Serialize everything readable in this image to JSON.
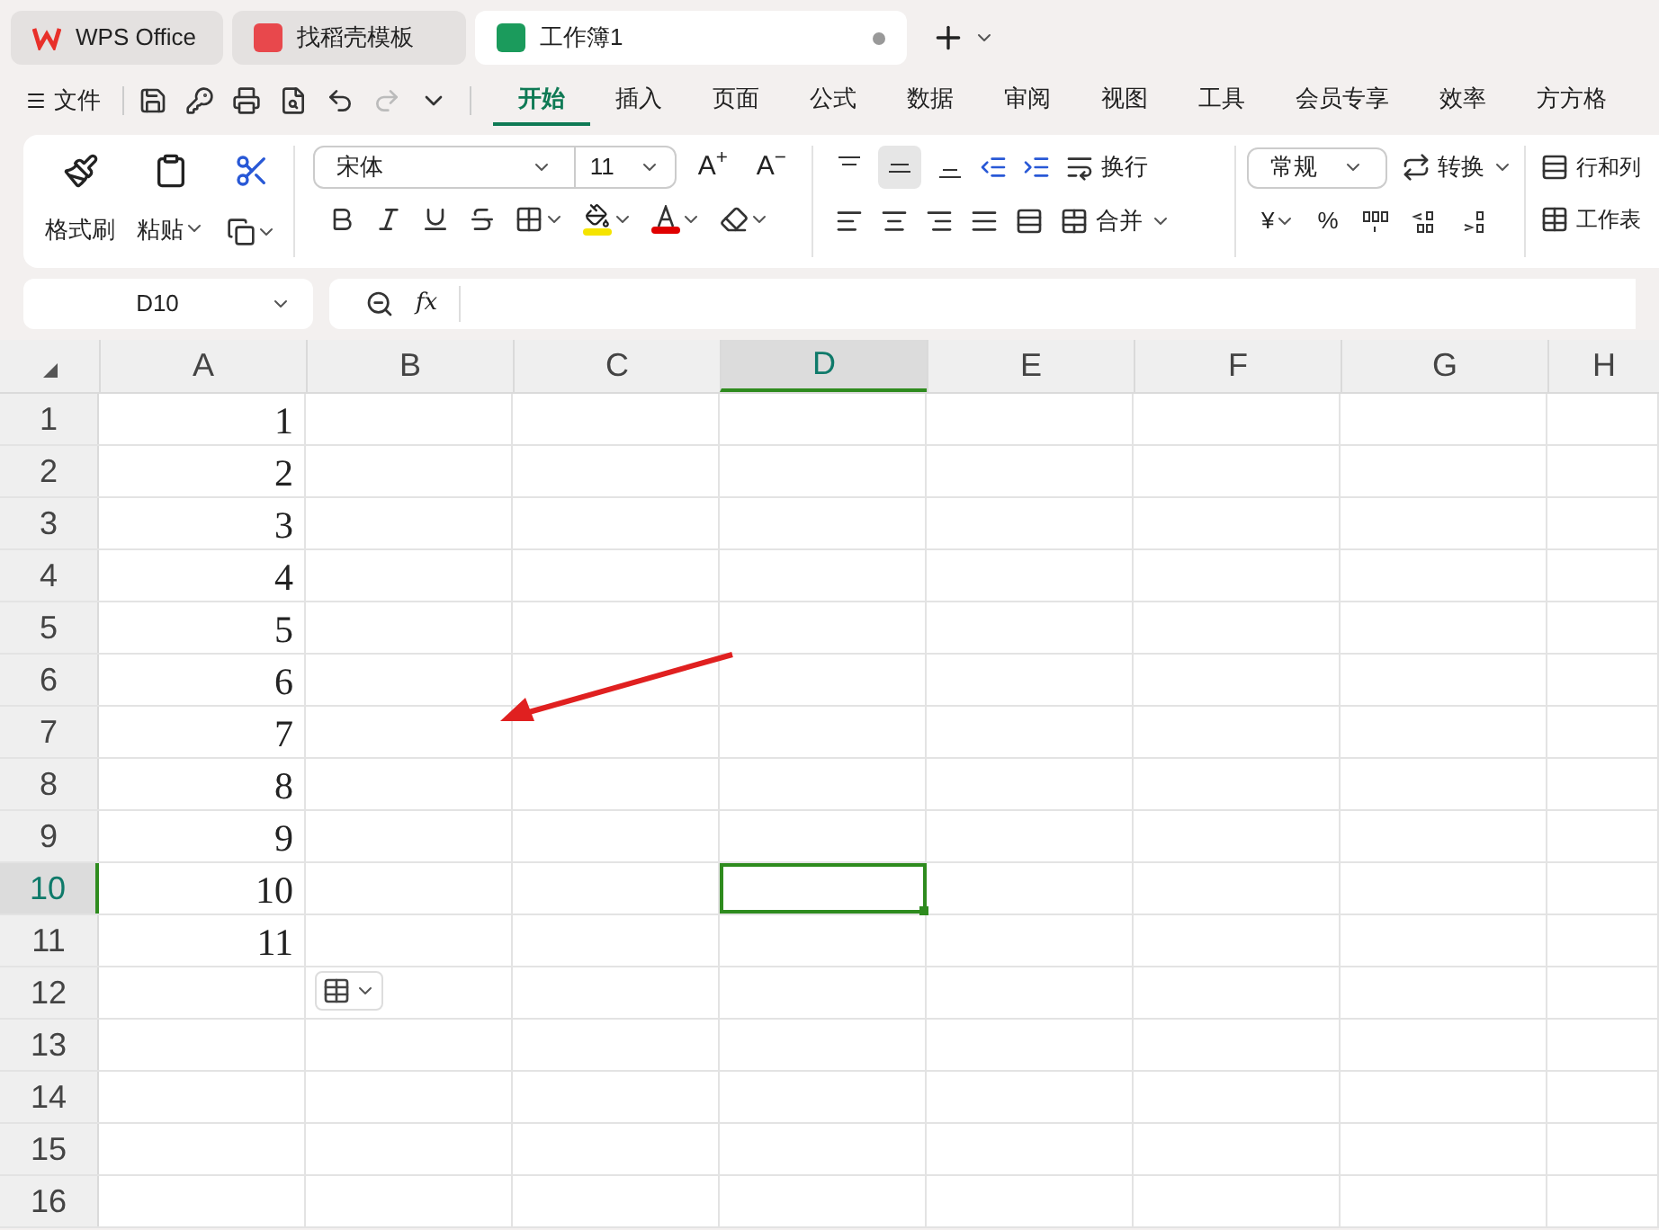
{
  "tabs": [
    {
      "label": "WPS Office",
      "kind": "home",
      "selected": false
    },
    {
      "label": "找稻壳模板",
      "kind": "template",
      "selected": false
    },
    {
      "label": "工作簿1",
      "kind": "sheet",
      "selected": true
    }
  ],
  "menu": {
    "file": "文件",
    "items": [
      {
        "label": "开始",
        "selected": true
      },
      {
        "label": "插入",
        "selected": false
      },
      {
        "label": "页面",
        "selected": false
      },
      {
        "label": "公式",
        "selected": false
      },
      {
        "label": "数据",
        "selected": false
      },
      {
        "label": "审阅",
        "selected": false
      },
      {
        "label": "视图",
        "selected": false
      },
      {
        "label": "工具",
        "selected": false
      },
      {
        "label": "会员专享",
        "selected": false
      },
      {
        "label": "效率",
        "selected": false
      },
      {
        "label": "方方格",
        "selected": false
      }
    ]
  },
  "ribbon": {
    "format_painter": "格式刷",
    "paste": "粘贴",
    "font": "宋体",
    "font_size": "11",
    "grow_font": "A$^{+}$",
    "shrink_font": "A$^{−}$",
    "vertical_align": [
      {
        "selected": false
      },
      {
        "selected": true
      },
      {
        "selected": false
      }
    ],
    "wrap": "换行",
    "merge": "合并",
    "number_format": "常规",
    "convert": "转换",
    "currency": "¥",
    "percent": "%",
    "rows_cols": "行和列",
    "worksheet": "工作表"
  },
  "name_box": "D10",
  "function_label": "fx",
  "columns": [
    {
      "label": "A",
      "selected": false
    },
    {
      "label": "B",
      "selected": false
    },
    {
      "label": "C",
      "selected": false
    },
    {
      "label": "D",
      "selected": true
    },
    {
      "label": "E",
      "selected": false
    },
    {
      "label": "F",
      "selected": false
    },
    {
      "label": "G",
      "selected": false
    },
    {
      "label": "H",
      "selected": false
    }
  ],
  "rows": [
    {
      "label": "1",
      "selected": false,
      "a": "1"
    },
    {
      "label": "2",
      "selected": false,
      "a": "2"
    },
    {
      "label": "3",
      "selected": false,
      "a": "3"
    },
    {
      "label": "4",
      "selected": false,
      "a": "4"
    },
    {
      "label": "5",
      "selected": false,
      "a": "5"
    },
    {
      "label": "6",
      "selected": false,
      "a": "6"
    },
    {
      "label": "7",
      "selected": false,
      "a": "7"
    },
    {
      "label": "8",
      "selected": false,
      "a": "8"
    },
    {
      "label": "9",
      "selected": false,
      "a": "9"
    },
    {
      "label": "10",
      "selected": true,
      "a": "10"
    },
    {
      "label": "11",
      "selected": false,
      "a": "11"
    },
    {
      "label": "12",
      "selected": false
    },
    {
      "label": "13",
      "selected": false
    },
    {
      "label": "14",
      "selected": false
    },
    {
      "label": "15",
      "selected": false
    },
    {
      "label": "16",
      "selected": false
    }
  ]
}
